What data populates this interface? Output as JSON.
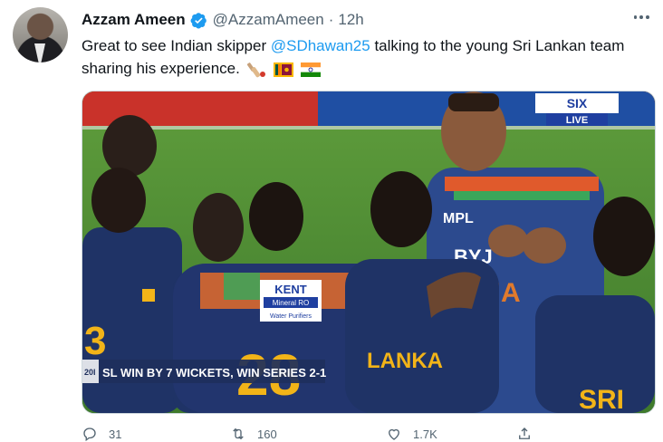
{
  "tweet": {
    "display_name": "Azzam Ameen",
    "handle": "@AzzamAmeen",
    "separator": "·",
    "time": "12h",
    "text_before": "Great to see Indian skipper ",
    "mention": "@SDhawan25",
    "text_after": " talking to the young Sri Lankan team sharing his experience.",
    "emojis": [
      "cricket-bat-icon",
      "sri-lanka-flag-icon",
      "india-flag-icon"
    ]
  },
  "media": {
    "broadcaster_logo": "SIX",
    "live_label": "LIVE",
    "ticker_prefix": "20I",
    "ticker_text": "SL WIN BY 7 WICKETS, WIN SERIES 2-1",
    "sponsor_top": "KENT",
    "sponsor_mid": "Mineral RO",
    "sponsor_bottom": "Water Purifiers",
    "jersey_left_number": "3",
    "jersey_center_number": "28",
    "jersey_right_text": "LANKA",
    "jersey_india_text": "DIA",
    "jersey_mpl": "MPL",
    "jersey_byju": "BYJ",
    "jersey_sri": "SRI"
  },
  "actions": {
    "reply_count": "31",
    "retweet_count": "160",
    "like_count": "1.7K"
  },
  "colors": {
    "link": "#1d9bf0",
    "verified": "#1d9bf0",
    "muted": "#536471"
  }
}
